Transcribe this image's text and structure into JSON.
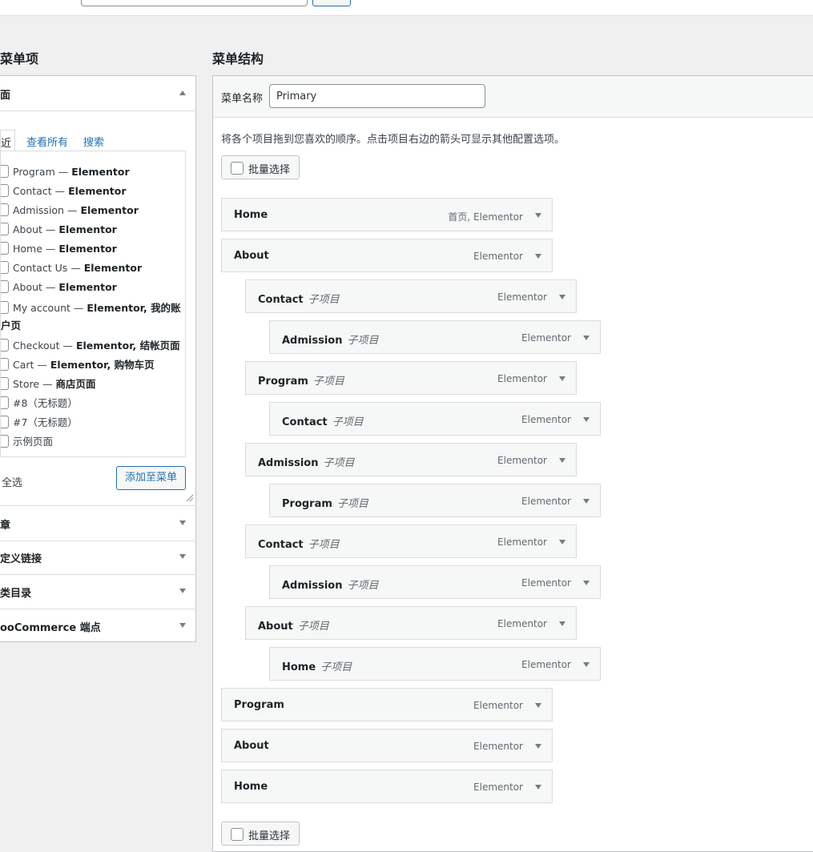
{
  "left_panel": {
    "title": "菜单项",
    "pages_section": {
      "title": "面",
      "tabs": [
        "近",
        "查看所有",
        "搜索"
      ],
      "items": [
        {
          "label": "Program — ",
          "bold": "Elementor"
        },
        {
          "label": "Contact — ",
          "bold": "Elementor"
        },
        {
          "label": "Admission — ",
          "bold": "Elementor"
        },
        {
          "label": "About — ",
          "bold": "Elementor"
        },
        {
          "label": "Home — ",
          "bold": "Elementor"
        },
        {
          "label": "Contact Us — ",
          "bold": "Elementor"
        },
        {
          "label": "About — ",
          "bold": "Elementor"
        },
        {
          "label": "My account — ",
          "bold": "Elementor, 我的账",
          "cont": "户页"
        },
        {
          "label": "Checkout — ",
          "bold": "Elementor, 结帐页面"
        },
        {
          "label": "Cart — ",
          "bold": "Elementor, 购物车页"
        },
        {
          "label": "Store — ",
          "bold": "商店页面"
        },
        {
          "label": "#8（无标题）",
          "bold": ""
        },
        {
          "label": "#7（无标题）",
          "bold": ""
        },
        {
          "label": "示例页面",
          "bold": ""
        }
      ],
      "select_all": "全选",
      "add_button": "添加至菜单"
    },
    "other_sections": [
      "章",
      "定义链接",
      "类目录",
      "ooCommerce 端点"
    ]
  },
  "right_panel": {
    "title": "菜单结构",
    "menu_name_label": "菜单名称",
    "menu_name_value": "Primary",
    "instructions": "将各个项目拖到您喜欢的顺序。点击项目右边的箭头可显示其他配置选项。",
    "bulk_select": "批量选择",
    "sub_item_label": "子项目",
    "menu_items": [
      {
        "title": "Home",
        "type": "首页, Elementor",
        "depth": 0
      },
      {
        "title": "About",
        "type": "Elementor",
        "depth": 0
      },
      {
        "title": "Contact",
        "type": "Elementor",
        "depth": 1
      },
      {
        "title": "Admission",
        "type": "Elementor",
        "depth": 2
      },
      {
        "title": "Program",
        "type": "Elementor",
        "depth": 1
      },
      {
        "title": "Contact",
        "type": "Elementor",
        "depth": 2
      },
      {
        "title": "Admission",
        "type": "Elementor",
        "depth": 1
      },
      {
        "title": "Program",
        "type": "Elementor",
        "depth": 2
      },
      {
        "title": "Contact",
        "type": "Elementor",
        "depth": 1
      },
      {
        "title": "Admission",
        "type": "Elementor",
        "depth": 2
      },
      {
        "title": "About",
        "type": "Elementor",
        "depth": 1
      },
      {
        "title": "Home",
        "type": "Elementor",
        "depth": 2
      },
      {
        "title": "Program",
        "type": "Elementor",
        "depth": 0
      },
      {
        "title": "About",
        "type": "Elementor",
        "depth": 0
      },
      {
        "title": "Home",
        "type": "Elementor",
        "depth": 0
      }
    ]
  }
}
